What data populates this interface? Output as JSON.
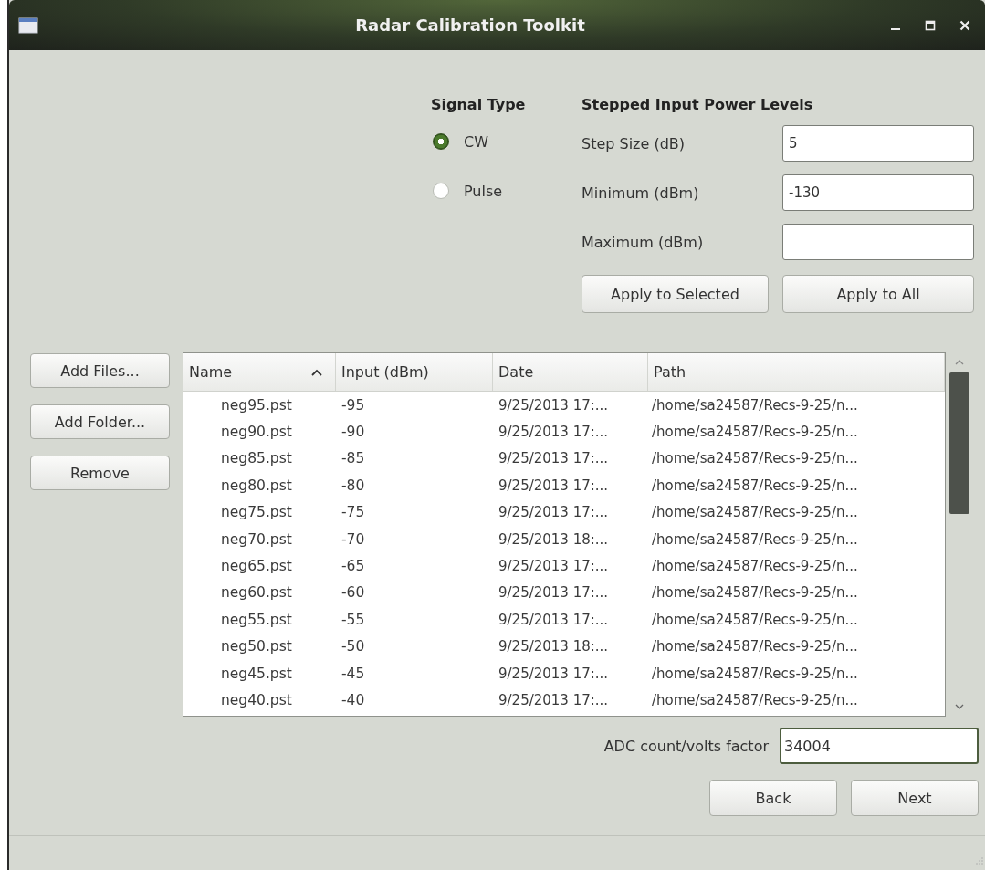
{
  "window": {
    "title": "Radar Calibration Toolkit"
  },
  "signal_type": {
    "heading": "Signal Type",
    "options": [
      {
        "label": "CW",
        "selected": true
      },
      {
        "label": "Pulse",
        "selected": false
      }
    ]
  },
  "power_levels": {
    "heading": "Stepped Input Power Levels",
    "fields": [
      {
        "label": "Step Size (dB)",
        "value": "5"
      },
      {
        "label": "Minimum (dBm)",
        "value": "-130"
      },
      {
        "label": "Maximum (dBm)"
      }
    ],
    "buttons": [
      "Apply to Selected",
      "Apply to All"
    ]
  },
  "file_buttons": [
    "Add Files...",
    "Add Folder...",
    "Remove"
  ],
  "table": {
    "columns": [
      {
        "label": "Name",
        "sorted": true
      },
      {
        "label": "Input (dBm)",
        "sorted": false
      },
      {
        "label": "Date",
        "sorted": false
      },
      {
        "label": "Path",
        "sorted": false
      }
    ],
    "rows": [
      [
        "neg95.pst",
        "-95",
        "9/25/2013 17:...",
        "/home/sa24587/Recs-9-25/n..."
      ],
      [
        "neg90.pst",
        "-90",
        "9/25/2013 17:...",
        "/home/sa24587/Recs-9-25/n..."
      ],
      [
        "neg85.pst",
        "-85",
        "9/25/2013 17:...",
        "/home/sa24587/Recs-9-25/n..."
      ],
      [
        "neg80.pst",
        "-80",
        "9/25/2013 17:...",
        "/home/sa24587/Recs-9-25/n..."
      ],
      [
        "neg75.pst",
        "-75",
        "9/25/2013 17:...",
        "/home/sa24587/Recs-9-25/n..."
      ],
      [
        "neg70.pst",
        "-70",
        "9/25/2013 18:...",
        "/home/sa24587/Recs-9-25/n..."
      ],
      [
        "neg65.pst",
        "-65",
        "9/25/2013 17:...",
        "/home/sa24587/Recs-9-25/n..."
      ],
      [
        "neg60.pst",
        "-60",
        "9/25/2013 17:...",
        "/home/sa24587/Recs-9-25/n..."
      ],
      [
        "neg55.pst",
        "-55",
        "9/25/2013 17:...",
        "/home/sa24587/Recs-9-25/n..."
      ],
      [
        "neg50.pst",
        "-50",
        "9/25/2013 18:...",
        "/home/sa24587/Recs-9-25/n..."
      ],
      [
        "neg45.pst",
        "-45",
        "9/25/2013 17:...",
        "/home/sa24587/Recs-9-25/n..."
      ],
      [
        "neg40.pst",
        "-40",
        "9/25/2013 17:...",
        "/home/sa24587/Recs-9-25/n..."
      ]
    ]
  },
  "adc": {
    "label": "ADC count/volts factor",
    "value": "34004",
    "focused": true
  },
  "nav_buttons": [
    "Back",
    "Next"
  ]
}
